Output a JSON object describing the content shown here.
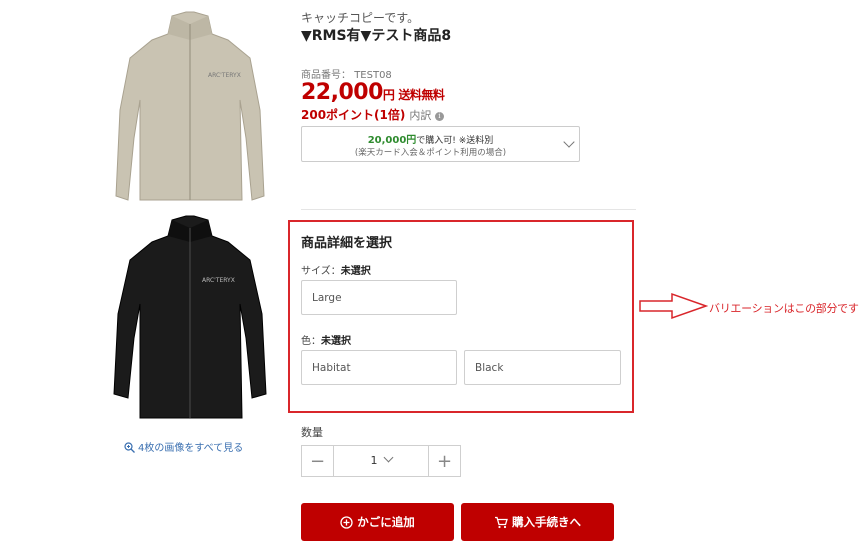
{
  "product": {
    "catch_copy": "キャッチコピーです。",
    "title": "▼RMS有▼テスト商品8",
    "code_label": "商品番号：",
    "code_value": "TEST08",
    "price": "22,000",
    "price_unit": "円",
    "shipping": "送料無料",
    "points": "200ポイント(1倍)",
    "tax": "内訳"
  },
  "card_offer": {
    "amount": "20,000円",
    "text": "で購入可! ※送料別",
    "note": "(楽天カード入会＆ポイント利用の場合)"
  },
  "selection": {
    "heading": "商品詳細を選択",
    "size_label": "サイズ：",
    "size_value": "未選択",
    "size_options": [
      "Large"
    ],
    "color_label": "色：",
    "color_value": "未選択",
    "color_options": [
      "Habitat",
      "Black"
    ]
  },
  "annotation": {
    "text": "バリエーションはこの部分です",
    "color": "#d9262b"
  },
  "gallery": {
    "see_all": "4枚の画像をすべて見る"
  },
  "quantity": {
    "label": "数量",
    "value": "1",
    "minus": "−",
    "plus": "+"
  },
  "buttons": {
    "add_to_cart": "かごに追加",
    "checkout": "購入手続きへ"
  },
  "colors": {
    "brand_red": "#bf0000",
    "green": "#2e8b2e"
  }
}
